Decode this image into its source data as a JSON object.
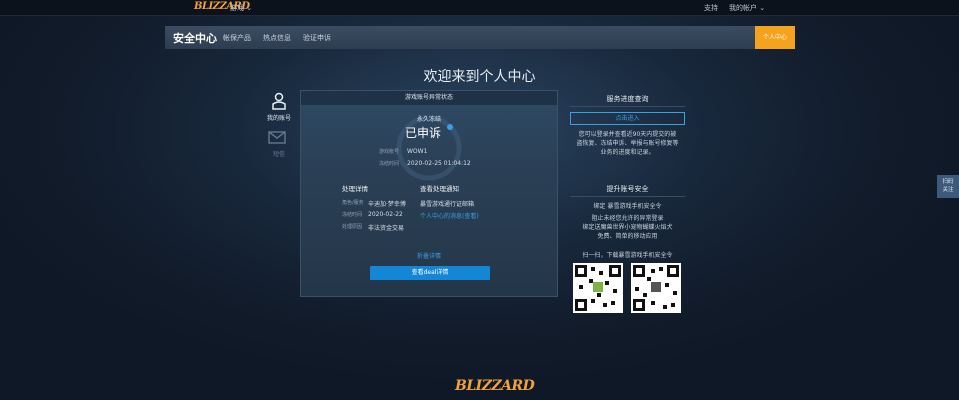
{
  "topbar": {
    "logo": "BLIZZARD",
    "games": "游戏 ⌄",
    "support": "支持",
    "my_account": "我的帐户 ⌄"
  },
  "navbar": {
    "logo": "安全中心",
    "items": [
      "帐保产品",
      "热点信息",
      "验证申诉"
    ],
    "personal": "个人中心"
  },
  "page": {
    "title": "欢迎来到个人中心"
  },
  "sidebar": {
    "account": "我的账号",
    "messages": "短信"
  },
  "panel": {
    "header": "游戏账号异常状态",
    "status_type": "永久冻结",
    "status": "已申诉",
    "fields": [
      {
        "key": "游戏帐号",
        "value": "WOW1"
      },
      {
        "key": "冻结时间",
        "value": "2020-02-25 01:04:12"
      }
    ],
    "detail_title": "处理详情",
    "details": [
      {
        "key": "角色/服务",
        "value": "辛迪加·梦幸博"
      },
      {
        "key": "冻结时间",
        "value": "2020-02-22"
      },
      {
        "key": "处理原因",
        "value": "非法资金交易"
      }
    ],
    "notice_title": "查看处理通知",
    "notice_lines": [
      "暴雪游戏通行证邮箱"
    ],
    "notice_link": "个人中心的消息(查看)",
    "expand": "折叠详情",
    "view_button": "查看deal详情"
  },
  "right": {
    "service_title": "服务进度查询",
    "query_button": "点击进入",
    "service_desc": [
      "您可以登录并查看近90天内提交的被",
      "盗恢复、冻结申诉、举报与账号修复等",
      "业务的进度和记录。"
    ],
    "upgrade_title": "提升账号安全",
    "upgrade_line1": "绑定 暴雪游戏手机安全令",
    "upgrade_desc": [
      "阻止未经您允许的异常登录",
      "绑定送魔兽世界小宠物蝴蝶火焰犬",
      "免费、简单的移动应用"
    ],
    "download_line": "扫一扫，下载暴雪游戏手机安全令"
  },
  "feedback": {
    "line1": "扫码",
    "line2": "关注"
  },
  "footer": {
    "logo": "BLIZZARD"
  }
}
